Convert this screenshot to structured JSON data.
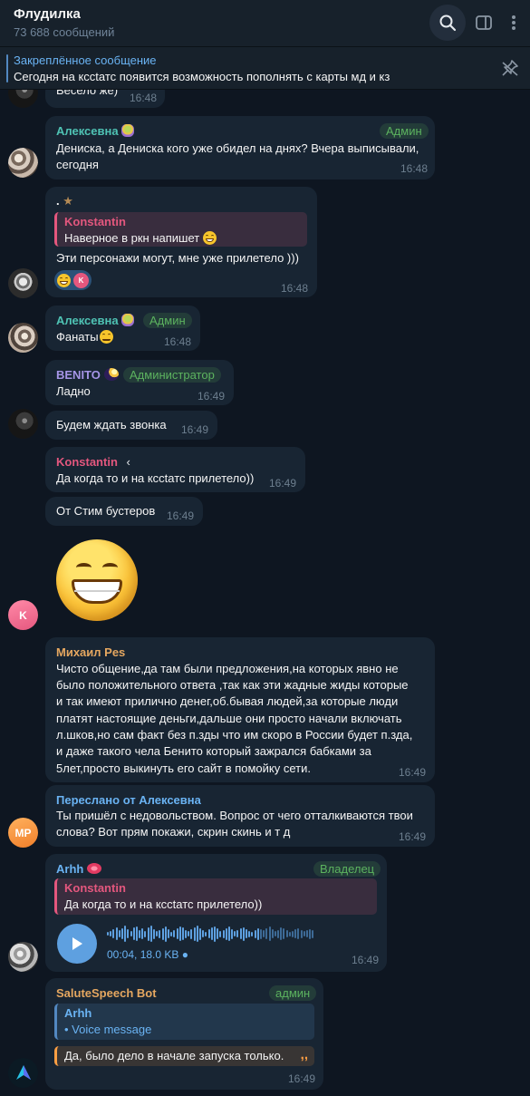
{
  "header": {
    "title": "Флудилка",
    "subtitle": "73 688 сообщений"
  },
  "pinned": {
    "title": "Закреплённое сообщение",
    "text": "Сегодня на кссtатс появится возможность пополнять с карты мд и кз"
  },
  "messages": [
    {
      "text": "Весело же)",
      "time": "16:48"
    },
    {
      "sender": "Алексевна",
      "role": "Админ",
      "text_line1": "Дениска, а Дениска кого уже обидел на днях? Вчера выписывали,",
      "text_line2": "сегодня",
      "time": "16:48"
    },
    {
      "sender": ".",
      "reply_name": "Konstantin",
      "reply_text": "Наверное в ркн напишет",
      "text": "Эти персонажи могут, мне уже прилетело )))",
      "reaction_initial": "K",
      "time": "16:48"
    },
    {
      "sender": "Алексевна",
      "role": "Админ",
      "text": "Фанаты",
      "time": "16:48"
    },
    {
      "sender": "BENITO",
      "role": "Администратор",
      "text": "Ладно",
      "time": "16:49"
    },
    {
      "text": "Будем ждать звонка",
      "time": "16:49"
    },
    {
      "sender": "Konstantin",
      "text": "Да когда то и на кссtатс прилетело))",
      "time": "16:49"
    },
    {
      "text": "От Стим бустеров",
      "time": "16:49"
    },
    {
      "avatar_initial": "K"
    },
    {
      "sender": "Михаил Pes",
      "lines": [
        "Чисто общение,да там были предложения,на которых явно не",
        "было положительного ответа ,так как эти жадные жиды которые",
        "и так имеют прилично денег,об.бывая людей,за которые люди",
        "платят настоящие деньги,дальше они просто начали включать",
        "л.шков,но сам факт без п.зды что им скоро в России будет п.зда,",
        "и даже такого чела Бенито который зажрался бабками за",
        "5лет,просто выкинуть его сайт в помойку сети."
      ],
      "time": "16:49"
    },
    {
      "forwarded": "Переслано от Алексевна",
      "text_line1": "Ты пришёл с недовольством. Вопрос от чего отталкиваются твои",
      "text_line2": "слова? Вот прям покажи, скрин скинь и т д",
      "avatar_initial": "MP",
      "time": "16:49"
    },
    {
      "sender": "Arhh",
      "role": "Владелец",
      "reply_name": "Konstantin",
      "reply_text": "Да когда то и на кссtатс прилетело))",
      "voice_meta": "00:04, 18.0 KB",
      "time": "16:49"
    },
    {
      "sender": "SaluteSpeech Bot",
      "role": "админ",
      "reply_name": "Arhh",
      "reply_text": "• Voice message",
      "quote": "Да, было дело в начале запуска только.",
      "time": "16:49"
    }
  ],
  "colors": {
    "background": "#0e1621",
    "bubble": "#182533",
    "accent": "#6ab3f3",
    "admin_badge": "#5cb35f"
  },
  "icons": [
    "search-icon",
    "sidebar-icon",
    "more-icon",
    "pin-off-icon",
    "play-icon"
  ]
}
